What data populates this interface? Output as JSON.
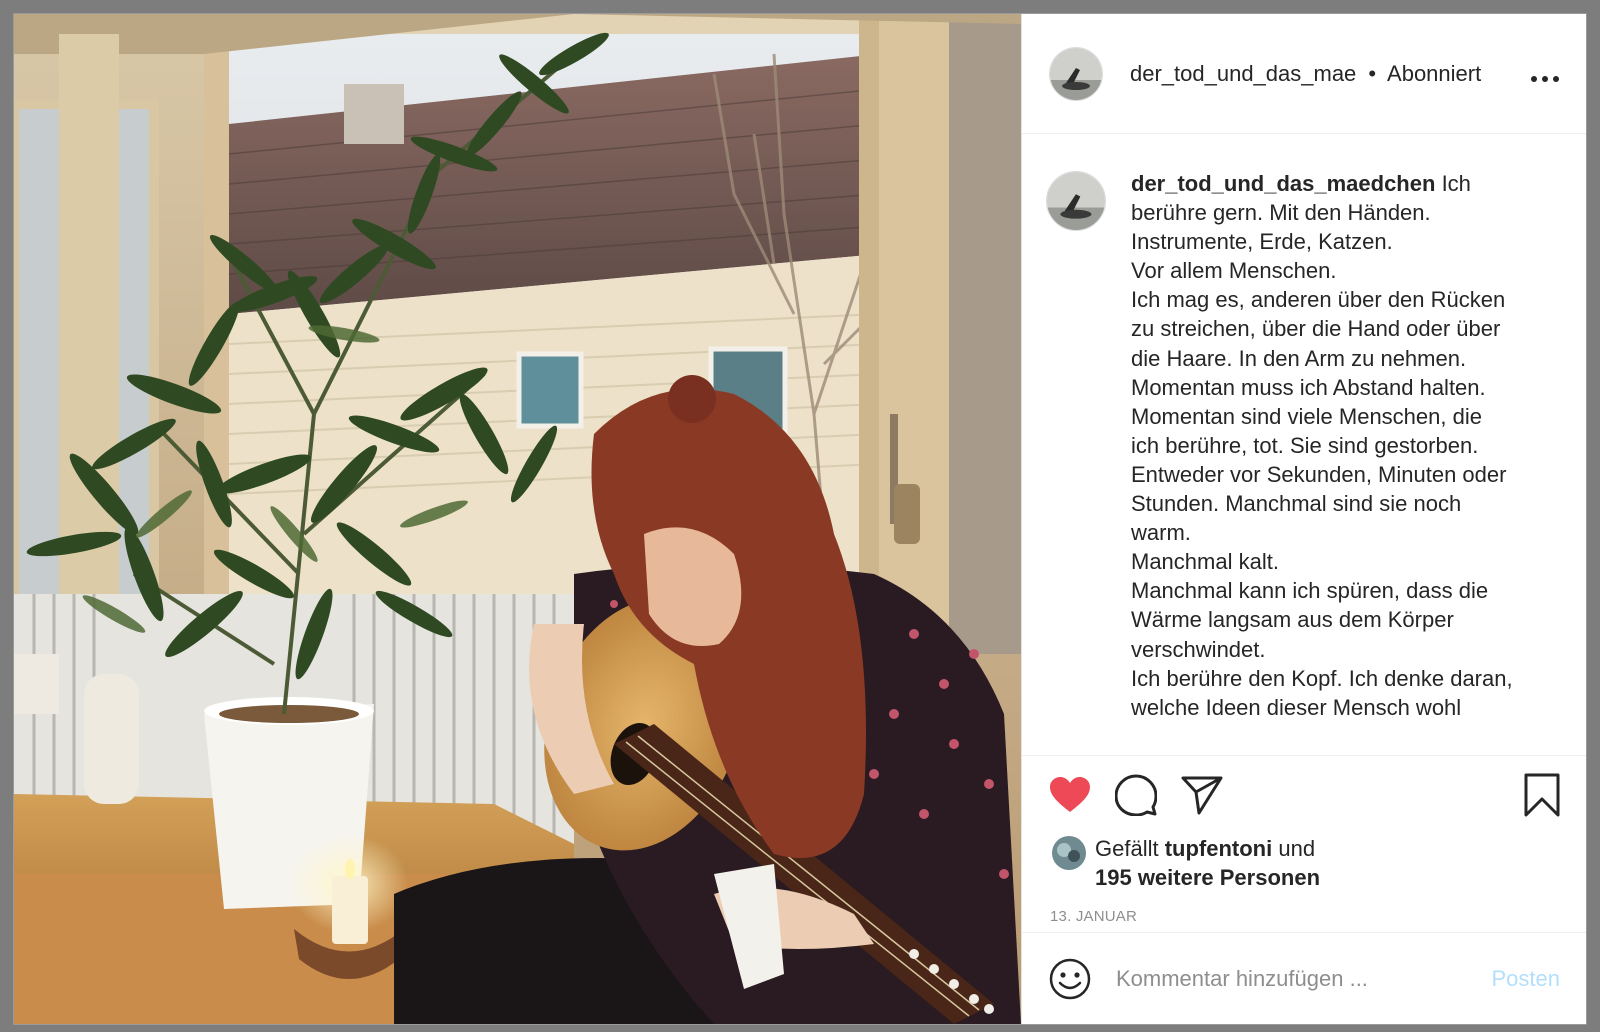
{
  "header": {
    "username": "der_tod_und_das_mae",
    "separator": "•",
    "follow_status": "Abonniert",
    "more_icon": "more-horizontal-icon"
  },
  "caption": {
    "username": "der_tod_und_das_maedchen",
    "lines": [
      "Ich",
      "berühre gern. Mit den Händen.",
      "Instrumente, Erde, Katzen.",
      "Vor allem Menschen.",
      "Ich mag es, anderen über den Rücken",
      "zu streichen, über die Hand oder über",
      "die Haare. In den Arm zu nehmen.",
      "Momentan muss ich Abstand halten.",
      "Momentan sind viele Menschen, die",
      "ich berühre, tot. Sie sind gestorben.",
      "Entweder vor Sekunden, Minuten oder",
      "Stunden. Manchmal sind sie noch",
      "warm.",
      "Manchmal kalt.",
      "Manchmal kann ich spüren, dass die",
      "Wärme langsam aus dem Körper",
      "verschwindet.",
      "Ich berühre den Kopf. Ich denke daran,",
      "welche Ideen dieser Mensch wohl"
    ]
  },
  "actions": {
    "like_icon": "heart-filled-icon",
    "comment_icon": "comment-icon",
    "share_icon": "send-icon",
    "save_icon": "bookmark-icon",
    "like_color": "#ed4956"
  },
  "likes": {
    "prefix": "Gefällt",
    "user": "tupfentoni",
    "conjunction": "und",
    "others": "195 weitere Personen"
  },
  "date": "13. JANUAR",
  "comment": {
    "placeholder": "Kommentar hinzufügen ...",
    "post_label": "Posten",
    "emoji_icon": "smiley-icon"
  }
}
